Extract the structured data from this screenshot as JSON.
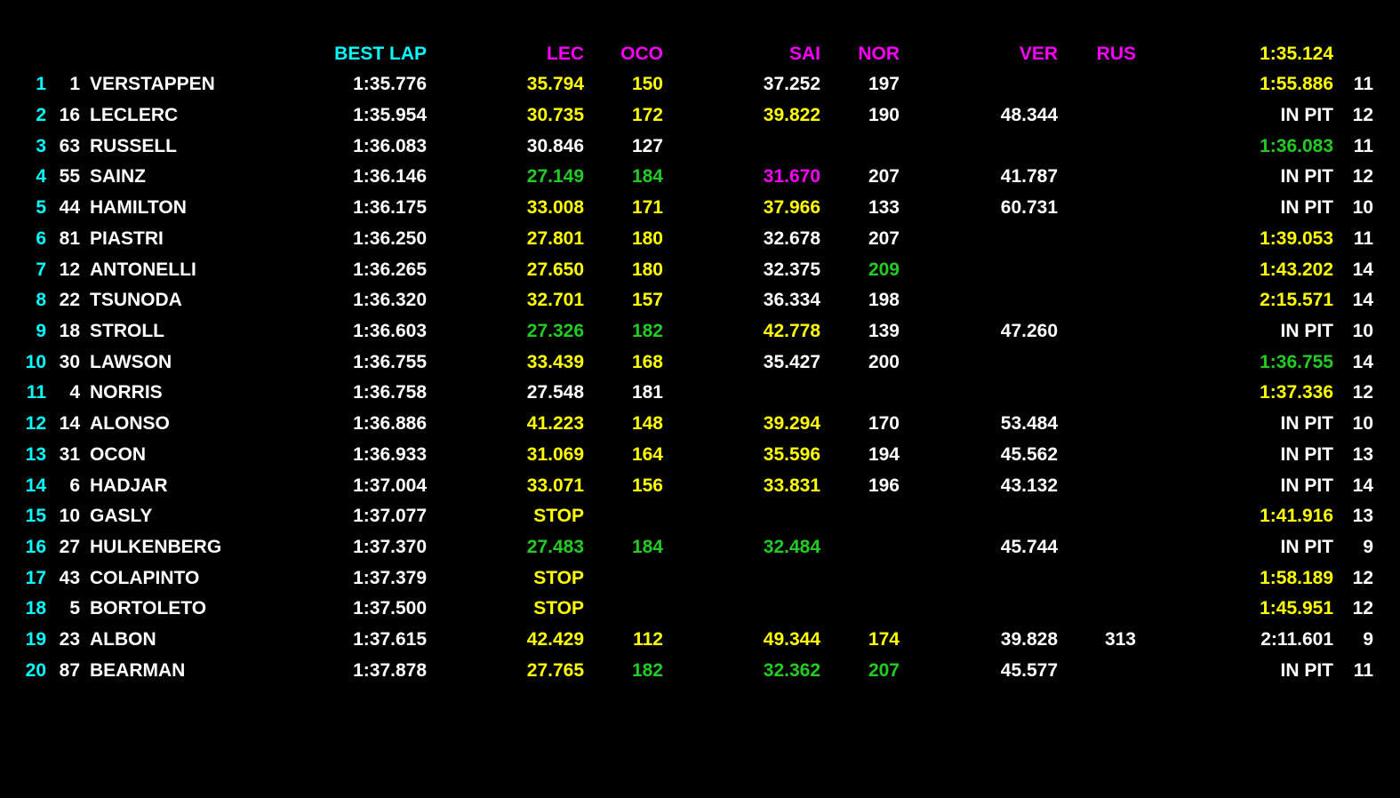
{
  "colors": {
    "background": "#000000",
    "white": "#ffffff",
    "cyan": "#00ffff",
    "magenta": "#ff00ff",
    "yellow": "#ffff00",
    "green": "#22cc22",
    "purple": "#ff00ff"
  },
  "header": {
    "best_lap": "BEST LAP",
    "s1_driver": "LEC",
    "s1_speed_driver": "OCO",
    "s2_driver": "SAI",
    "s2_speed_driver": "NOR",
    "s3_driver": "VER",
    "s3_speed_driver": "RUS",
    "overall_best": "1:35.124"
  },
  "rows": [
    {
      "pos": "1",
      "num": "1",
      "name": "VERSTAPPEN",
      "best": "1:35.776",
      "s1": "35.794",
      "s1c": "yellow",
      "s1s": "150",
      "s1sc": "yellow",
      "s2": "37.252",
      "s2c": "white",
      "s2s": "197",
      "s2sc": "white",
      "s3": "",
      "s3c": "white",
      "s3s": "",
      "s3sc": "white",
      "last": "1:55.886",
      "lastc": "yellow",
      "laps": "11"
    },
    {
      "pos": "2",
      "num": "16",
      "name": "LECLERC",
      "best": "1:35.954",
      "s1": "30.735",
      "s1c": "yellow",
      "s1s": "172",
      "s1sc": "yellow",
      "s2": "39.822",
      "s2c": "yellow",
      "s2s": "190",
      "s2sc": "white",
      "s3": "48.344",
      "s3c": "white",
      "s3s": "",
      "s3sc": "white",
      "last": "IN PIT",
      "lastc": "white",
      "laps": "12"
    },
    {
      "pos": "3",
      "num": "63",
      "name": "RUSSELL",
      "best": "1:36.083",
      "s1": "30.846",
      "s1c": "white",
      "s1s": "127",
      "s1sc": "white",
      "s2": "",
      "s2c": "white",
      "s2s": "",
      "s2sc": "white",
      "s3": "",
      "s3c": "white",
      "s3s": "",
      "s3sc": "white",
      "last": "1:36.083",
      "lastc": "green",
      "laps": "11"
    },
    {
      "pos": "4",
      "num": "55",
      "name": "SAINZ",
      "best": "1:36.146",
      "s1": "27.149",
      "s1c": "green",
      "s1s": "184",
      "s1sc": "green",
      "s2": "31.670",
      "s2c": "purple",
      "s2s": "207",
      "s2sc": "white",
      "s3": "41.787",
      "s3c": "white",
      "s3s": "",
      "s3sc": "white",
      "last": "IN PIT",
      "lastc": "white",
      "laps": "12"
    },
    {
      "pos": "5",
      "num": "44",
      "name": "HAMILTON",
      "best": "1:36.175",
      "s1": "33.008",
      "s1c": "yellow",
      "s1s": "171",
      "s1sc": "yellow",
      "s2": "37.966",
      "s2c": "yellow",
      "s2s": "133",
      "s2sc": "white",
      "s3": "60.731",
      "s3c": "white",
      "s3s": "",
      "s3sc": "white",
      "last": "IN PIT",
      "lastc": "white",
      "laps": "10"
    },
    {
      "pos": "6",
      "num": "81",
      "name": "PIASTRI",
      "best": "1:36.250",
      "s1": "27.801",
      "s1c": "yellow",
      "s1s": "180",
      "s1sc": "yellow",
      "s2": "32.678",
      "s2c": "white",
      "s2s": "207",
      "s2sc": "white",
      "s3": "",
      "s3c": "white",
      "s3s": "",
      "s3sc": "white",
      "last": "1:39.053",
      "lastc": "yellow",
      "laps": "11"
    },
    {
      "pos": "7",
      "num": "12",
      "name": "ANTONELLI",
      "best": "1:36.265",
      "s1": "27.650",
      "s1c": "yellow",
      "s1s": "180",
      "s1sc": "yellow",
      "s2": "32.375",
      "s2c": "white",
      "s2s": "209",
      "s2sc": "green",
      "s3": "",
      "s3c": "white",
      "s3s": "",
      "s3sc": "white",
      "last": "1:43.202",
      "lastc": "yellow",
      "laps": "14"
    },
    {
      "pos": "8",
      "num": "22",
      "name": "TSUNODA",
      "best": "1:36.320",
      "s1": "32.701",
      "s1c": "yellow",
      "s1s": "157",
      "s1sc": "yellow",
      "s2": "36.334",
      "s2c": "white",
      "s2s": "198",
      "s2sc": "white",
      "s3": "",
      "s3c": "white",
      "s3s": "",
      "s3sc": "white",
      "last": "2:15.571",
      "lastc": "yellow",
      "laps": "14"
    },
    {
      "pos": "9",
      "num": "18",
      "name": "STROLL",
      "best": "1:36.603",
      "s1": "27.326",
      "s1c": "green",
      "s1s": "182",
      "s1sc": "green",
      "s2": "42.778",
      "s2c": "yellow",
      "s2s": "139",
      "s2sc": "white",
      "s3": "47.260",
      "s3c": "white",
      "s3s": "",
      "s3sc": "white",
      "last": "IN PIT",
      "lastc": "white",
      "laps": "10"
    },
    {
      "pos": "10",
      "num": "30",
      "name": "LAWSON",
      "best": "1:36.755",
      "s1": "33.439",
      "s1c": "yellow",
      "s1s": "168",
      "s1sc": "yellow",
      "s2": "35.427",
      "s2c": "white",
      "s2s": "200",
      "s2sc": "white",
      "s3": "",
      "s3c": "white",
      "s3s": "",
      "s3sc": "white",
      "last": "1:36.755",
      "lastc": "green",
      "laps": "14"
    },
    {
      "pos": "11",
      "num": "4",
      "name": "NORRIS",
      "best": "1:36.758",
      "s1": "27.548",
      "s1c": "white",
      "s1s": "181",
      "s1sc": "white",
      "s2": "",
      "s2c": "white",
      "s2s": "",
      "s2sc": "white",
      "s3": "",
      "s3c": "white",
      "s3s": "",
      "s3sc": "white",
      "last": "1:37.336",
      "lastc": "yellow",
      "laps": "12"
    },
    {
      "pos": "12",
      "num": "14",
      "name": "ALONSO",
      "best": "1:36.886",
      "s1": "41.223",
      "s1c": "yellow",
      "s1s": "148",
      "s1sc": "yellow",
      "s2": "39.294",
      "s2c": "yellow",
      "s2s": "170",
      "s2sc": "white",
      "s3": "53.484",
      "s3c": "white",
      "s3s": "",
      "s3sc": "white",
      "last": "IN PIT",
      "lastc": "white",
      "laps": "10"
    },
    {
      "pos": "13",
      "num": "31",
      "name": "OCON",
      "best": "1:36.933",
      "s1": "31.069",
      "s1c": "yellow",
      "s1s": "164",
      "s1sc": "yellow",
      "s2": "35.596",
      "s2c": "yellow",
      "s2s": "194",
      "s2sc": "white",
      "s3": "45.562",
      "s3c": "white",
      "s3s": "",
      "s3sc": "white",
      "last": "IN PIT",
      "lastc": "white",
      "laps": "13"
    },
    {
      "pos": "14",
      "num": "6",
      "name": "HADJAR",
      "best": "1:37.004",
      "s1": "33.071",
      "s1c": "yellow",
      "s1s": "156",
      "s1sc": "yellow",
      "s2": "33.831",
      "s2c": "yellow",
      "s2s": "196",
      "s2sc": "white",
      "s3": "43.132",
      "s3c": "white",
      "s3s": "",
      "s3sc": "white",
      "last": "IN PIT",
      "lastc": "white",
      "laps": "14"
    },
    {
      "pos": "15",
      "num": "10",
      "name": "GASLY",
      "best": "1:37.077",
      "s1": "STOP",
      "s1c": "yellow",
      "s1s": "",
      "s1sc": "white",
      "s2": "",
      "s2c": "white",
      "s2s": "",
      "s2sc": "white",
      "s3": "",
      "s3c": "white",
      "s3s": "",
      "s3sc": "white",
      "last": "1:41.916",
      "lastc": "yellow",
      "laps": "13"
    },
    {
      "pos": "16",
      "num": "27",
      "name": "HULKENBERG",
      "best": "1:37.370",
      "s1": "27.483",
      "s1c": "green",
      "s1s": "184",
      "s1sc": "green",
      "s2": "32.484",
      "s2c": "green",
      "s2s": "",
      "s2sc": "white",
      "s3": "45.744",
      "s3c": "white",
      "s3s": "",
      "s3sc": "white",
      "last": "IN PIT",
      "lastc": "white",
      "laps": "9"
    },
    {
      "pos": "17",
      "num": "43",
      "name": "COLAPINTO",
      "best": "1:37.379",
      "s1": "STOP",
      "s1c": "yellow",
      "s1s": "",
      "s1sc": "white",
      "s2": "",
      "s2c": "white",
      "s2s": "",
      "s2sc": "white",
      "s3": "",
      "s3c": "white",
      "s3s": "",
      "s3sc": "white",
      "last": "1:58.189",
      "lastc": "yellow",
      "laps": "12"
    },
    {
      "pos": "18",
      "num": "5",
      "name": "BORTOLETO",
      "best": "1:37.500",
      "s1": "STOP",
      "s1c": "yellow",
      "s1s": "",
      "s1sc": "white",
      "s2": "",
      "s2c": "white",
      "s2s": "",
      "s2sc": "white",
      "s3": "",
      "s3c": "white",
      "s3s": "",
      "s3sc": "white",
      "last": "1:45.951",
      "lastc": "yellow",
      "laps": "12"
    },
    {
      "pos": "19",
      "num": "23",
      "name": "ALBON",
      "best": "1:37.615",
      "s1": "42.429",
      "s1c": "yellow",
      "s1s": "112",
      "s1sc": "yellow",
      "s2": "49.344",
      "s2c": "yellow",
      "s2s": "174",
      "s2sc": "yellow",
      "s3": "39.828",
      "s3c": "white",
      "s3s": "313",
      "s3sc": "white",
      "last": "2:11.601",
      "lastc": "white",
      "laps": "9"
    },
    {
      "pos": "20",
      "num": "87",
      "name": "BEARMAN",
      "best": "1:37.878",
      "s1": "27.765",
      "s1c": "yellow",
      "s1s": "182",
      "s1sc": "green",
      "s2": "32.362",
      "s2c": "green",
      "s2s": "207",
      "s2sc": "green",
      "s3": "45.577",
      "s3c": "white",
      "s3s": "",
      "s3sc": "white",
      "last": "IN PIT",
      "lastc": "white",
      "laps": "11"
    }
  ]
}
